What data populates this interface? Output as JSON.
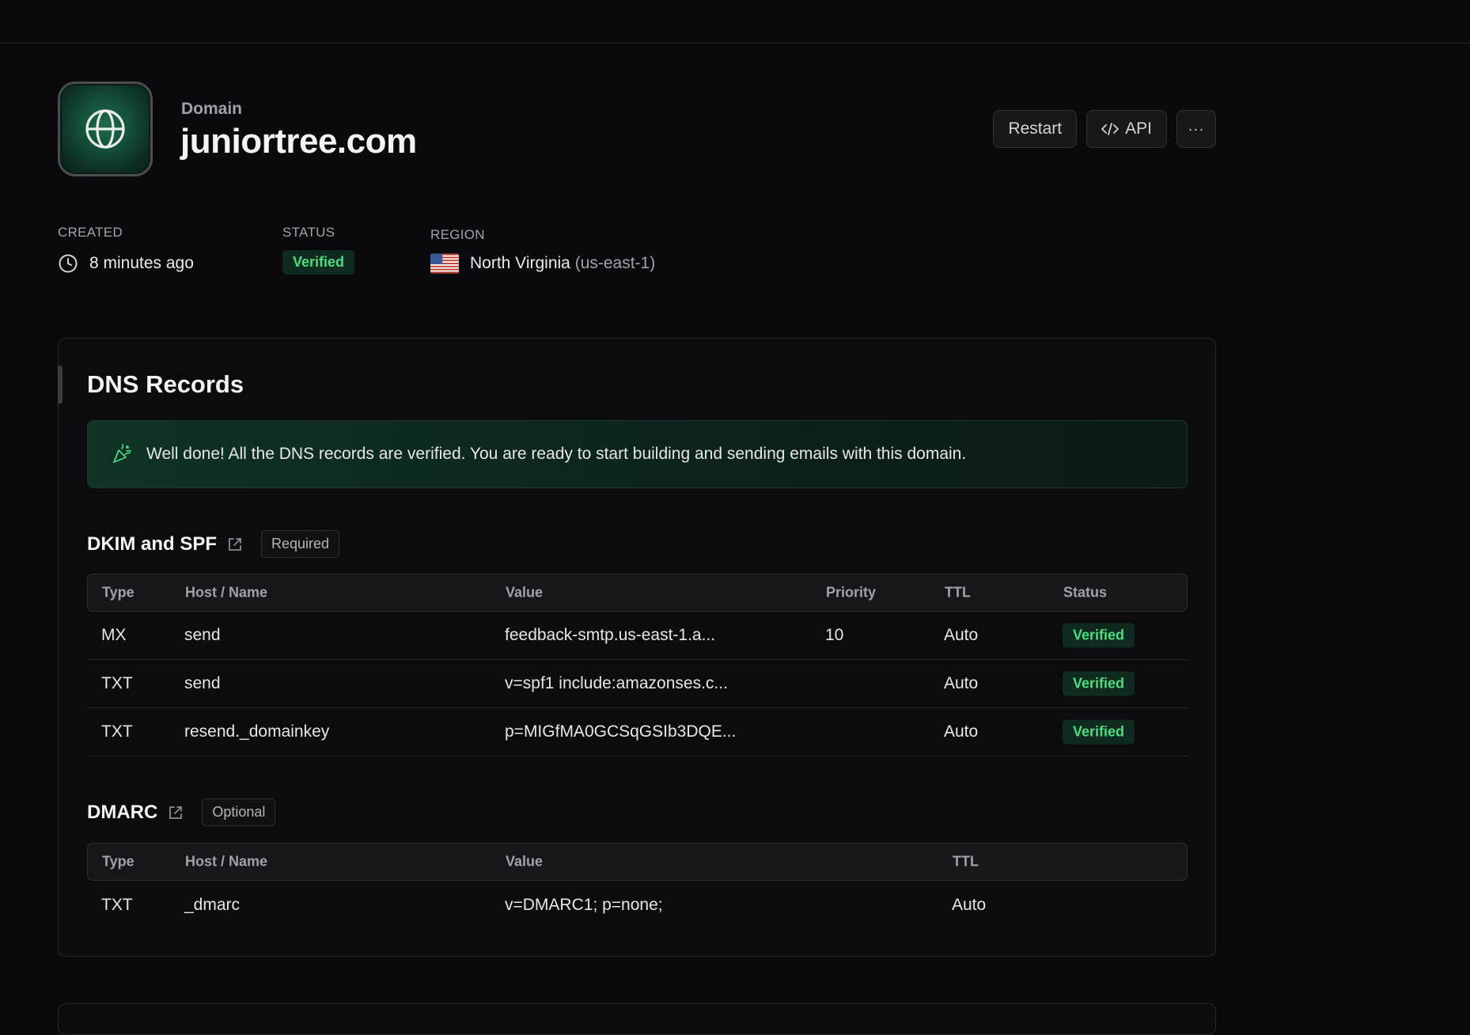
{
  "header": {
    "kicker": "Domain",
    "domain": "juniortree.com",
    "actions": {
      "restart": "Restart",
      "api": "API",
      "more": "···"
    }
  },
  "meta": {
    "created_label": "CREATED",
    "created_value": "8 minutes ago",
    "status_label": "STATUS",
    "status_value": "Verified",
    "region_label": "REGION",
    "region_name": "North Virginia",
    "region_code": "(us-east-1)"
  },
  "dns": {
    "title": "DNS Records",
    "alert": "Well done! All the DNS records are verified. You are ready to start building and sending emails with this domain.",
    "dkim": {
      "title": "DKIM and SPF",
      "tag": "Required",
      "columns": [
        "Type",
        "Host / Name",
        "Value",
        "Priority",
        "TTL",
        "Status"
      ],
      "rows": [
        {
          "type": "MX",
          "host": "send",
          "value": "feedback-smtp.us-east-1.a...",
          "priority": "10",
          "ttl": "Auto",
          "status": "Verified"
        },
        {
          "type": "TXT",
          "host": "send",
          "value": "v=spf1 include:amazonses.c...",
          "priority": "",
          "ttl": "Auto",
          "status": "Verified"
        },
        {
          "type": "TXT",
          "host": "resend._domainkey",
          "value": "p=MIGfMA0GCSqGSIb3DQE...",
          "priority": "",
          "ttl": "Auto",
          "status": "Verified"
        }
      ]
    },
    "dmarc": {
      "title": "DMARC",
      "tag": "Optional",
      "columns": [
        "Type",
        "Host / Name",
        "Value",
        "TTL"
      ],
      "rows": [
        {
          "type": "TXT",
          "host": "_dmarc",
          "value": "v=DMARC1; p=none;",
          "ttl": "Auto"
        }
      ]
    }
  },
  "colors": {
    "background": "#0a0a0e",
    "verified_text": "#4ade80",
    "verified_bg": "#0f2a1f",
    "brand_green": "#15523a"
  },
  "icons": {
    "domain": "globe-icon",
    "created": "clock-icon",
    "region": "us-flag-icon",
    "alert": "party-popper-icon",
    "section_link": "external-link-icon",
    "api": "code-icon"
  }
}
